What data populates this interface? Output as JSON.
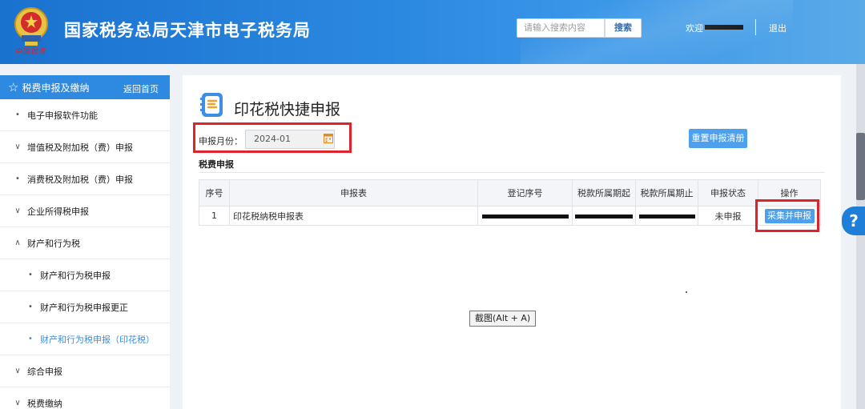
{
  "header": {
    "site_title": "国家税务总局天津市电子税务局",
    "emblem_sub": "中国税务",
    "search_placeholder": "请输入搜索内容",
    "search_button": "搜索",
    "welcome": "欢迎",
    "logout": "退出"
  },
  "sidebar": {
    "title": "税费申报及缴纳",
    "back_link": "返回首页",
    "items": [
      {
        "marker": "•",
        "label": "电子申报软件功能"
      },
      {
        "marker": "∨",
        "label": "增值税及附加税（费）申报"
      },
      {
        "marker": "•",
        "label": "消费税及附加税（费）申报"
      },
      {
        "marker": "∨",
        "label": "企业所得税申报"
      },
      {
        "marker": "∧",
        "label": "财产和行为税"
      },
      {
        "marker": "•",
        "label": "财产和行为税申报"
      },
      {
        "marker": "•",
        "label": "财产和行为税申报更正"
      },
      {
        "marker": "•",
        "label": "财产和行为税申报（印花税）"
      },
      {
        "marker": "∨",
        "label": "综合申报"
      },
      {
        "marker": "∨",
        "label": "税费缴纳"
      }
    ]
  },
  "main": {
    "page_title": "印花税快捷申报",
    "month_label": "申报月份：",
    "month_value": "2024-01",
    "reset_button": "重置申报清册",
    "section_title": "税费申报",
    "table": {
      "headers": [
        "序号",
        "申报表",
        "登记序号",
        "税款所属期起",
        "税款所属期止",
        "申报状态",
        "操作"
      ],
      "rows": [
        {
          "index": "1",
          "form": "印花税纳税申报表",
          "status": "未申报",
          "action": "采集并申报"
        }
      ]
    },
    "screenshot_tooltip": "截图(Alt + A)"
  },
  "help": {
    "label": "?"
  },
  "colors": {
    "header_blue": "#2b88e0",
    "accent": "#4ea0ec",
    "highlight_red": "#e0232b",
    "active_link": "#3b8fe0"
  },
  "icons": {
    "emblem": "tax-emblem-icon",
    "star": "star-icon",
    "page": "form-document-icon",
    "calendar": "calendar-icon",
    "help": "help-icon"
  }
}
